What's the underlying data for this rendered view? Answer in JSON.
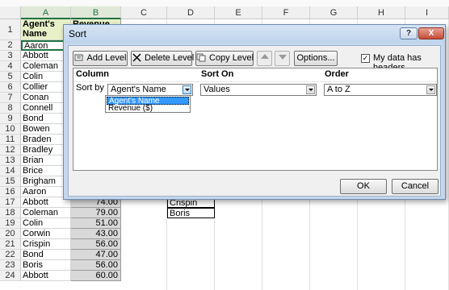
{
  "sheet": {
    "columns": [
      "A",
      "B",
      "C",
      "D",
      "E",
      "F",
      "G",
      "H",
      "I"
    ],
    "rows": [
      "1",
      "2",
      "3",
      "4",
      "5",
      "6",
      "7",
      "8",
      "9",
      "10",
      "11",
      "12",
      "13",
      "14",
      "15",
      "16",
      "17",
      "18",
      "19",
      "20",
      "21",
      "22",
      "23",
      "24"
    ],
    "header_a": "Agent's Name",
    "header_b": "Revenue",
    "names": [
      "Aaron",
      "Abbott",
      "Coleman",
      "Colin",
      "Collier",
      "Conan",
      "Connell",
      "Bond",
      "Bowen",
      "Braden",
      "Bradley",
      "Brian",
      "Brice",
      "Brigham",
      "Aaron",
      "Abbott",
      "Coleman",
      "Colin",
      "Corwin",
      "Crispin",
      "Bond",
      "Boris",
      "Abbott"
    ],
    "revenues_visible": [
      "74.00",
      "79.00",
      "51.00",
      "43.00",
      "56.00",
      "47.00",
      "56.00",
      "60.00"
    ],
    "d_cells": [
      "Crispin",
      "Boris"
    ]
  },
  "dialog": {
    "title": "Sort",
    "help": "?",
    "close": "X",
    "toolbar": {
      "add_level": "Add Level",
      "delete_level": "Delete Level",
      "copy_level": "Copy Level",
      "options": "Options...",
      "has_headers": "My data has headers"
    },
    "grid": {
      "col_column": "Column",
      "col_sort_on": "Sort On",
      "col_order": "Order",
      "sort_by": "Sort by",
      "column_value": "Agent's Name",
      "sort_on_value": "Values",
      "order_value": "A to Z",
      "dropdown_options": [
        "Agent's Name",
        "Revenue ($)"
      ]
    },
    "ok": "OK",
    "cancel": "Cancel"
  },
  "colors": {
    "dialog_frame": "#c4d7ec",
    "selection": "#3399ff",
    "header_fill": "#e8f0c8"
  }
}
